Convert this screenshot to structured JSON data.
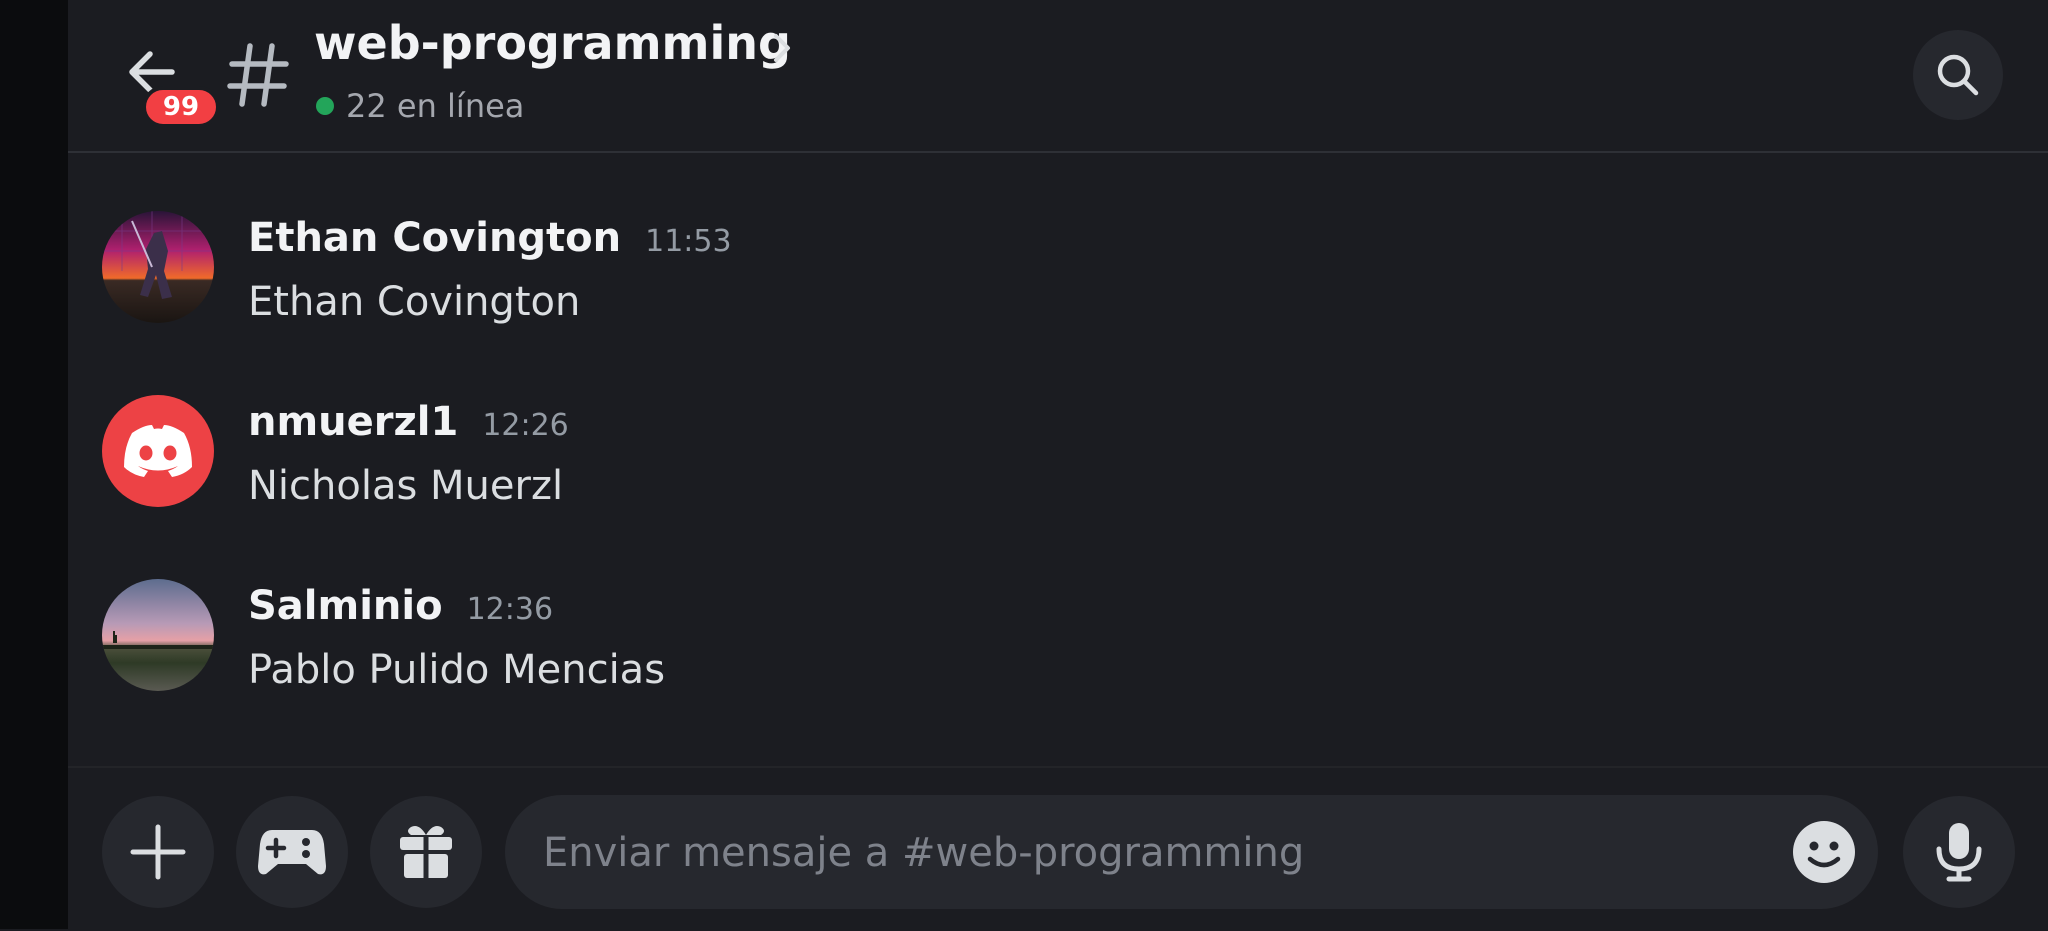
{
  "header": {
    "back_label": "back",
    "unread_badge": "99",
    "channel_name": "web-programming",
    "online_count": "22 en línea"
  },
  "messages": [
    {
      "author": "Ethan Covington",
      "time": "11:53",
      "text": "Ethan Covington",
      "avatar": "sunset-mecha-avatar"
    },
    {
      "author": "nmuerzl1",
      "time": "12:26",
      "text": "Nicholas Muerzl",
      "avatar": "discord-logo-avatar"
    },
    {
      "author": "Salminio",
      "time": "12:36",
      "text": "Pablo Pulido Mencias",
      "avatar": "sunset-landscape-avatar"
    }
  ],
  "composer": {
    "placeholder": "Enviar mensaje a #web-programming",
    "value": ""
  },
  "icons": {
    "back": "arrow-left-icon",
    "channel": "hash-icon",
    "chevron": "chevron-right-icon",
    "search": "search-icon",
    "add": "plus-icon",
    "games": "gamepad-icon",
    "gift": "gift-icon",
    "emoji": "emoji-icon",
    "mic": "microphone-icon"
  },
  "colors": {
    "background": "#1b1c21",
    "badge": "#f23f43",
    "online": "#23a55a",
    "discord_avatar": "#ed4245"
  }
}
